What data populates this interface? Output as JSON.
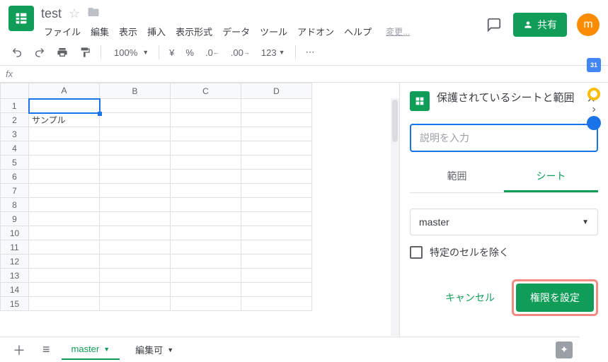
{
  "header": {
    "doc_title": "test",
    "menu": [
      "ファイル",
      "編集",
      "表示",
      "挿入",
      "表示形式",
      "データ",
      "ツール",
      "アドオン",
      "ヘルプ"
    ],
    "changes": "変更...",
    "share_label": "共有",
    "avatar_letter": "m"
  },
  "toolbar": {
    "zoom": "100%",
    "currency": "¥",
    "percent": "%",
    "dec_less": ".0",
    "dec_more": ".00",
    "format": "123"
  },
  "fxbar": {
    "label": "fx"
  },
  "sheet": {
    "cols": [
      "A",
      "B",
      "C",
      "D"
    ],
    "rows": [
      1,
      2,
      3,
      4,
      5,
      6,
      7,
      8,
      9,
      10,
      11,
      12,
      13,
      14,
      15
    ],
    "selected": "A1",
    "cells": {
      "A2": "サンプル"
    }
  },
  "sidepanel": {
    "title": "保護されているシートと範囲",
    "desc_placeholder": "説明を入力",
    "tab_range": "範囲",
    "tab_sheet": "シート",
    "sheet_select": "master",
    "exclude_label": "特定のセルを除く",
    "cancel": "キャンセル",
    "set_perm": "権限を設定"
  },
  "bottom": {
    "tabs": [
      {
        "name": "master",
        "active": true
      },
      {
        "name": "編集可",
        "active": false
      }
    ]
  },
  "rail": {
    "calendar_day": "31"
  }
}
